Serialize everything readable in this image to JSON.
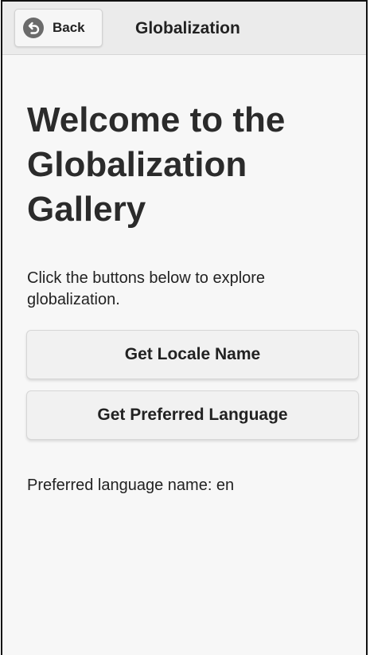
{
  "header": {
    "back_label": "Back",
    "title": "Globalization"
  },
  "main": {
    "heading": "Welcome to the Globalization Gallery",
    "intro": "Click the buttons below to explore globalization.",
    "buttons": {
      "locale_label": "Get Locale Name",
      "language_label": "Get Preferred Language"
    },
    "result_text": "Preferred language name: en"
  },
  "icons": {
    "back": "back-arrow-circle-icon"
  },
  "colors": {
    "header_bg": "#ebebeb",
    "page_bg": "#f7f7f7",
    "button_bg": "#f1f1f1",
    "text": "#222222",
    "back_icon": "#6b6b6b"
  }
}
